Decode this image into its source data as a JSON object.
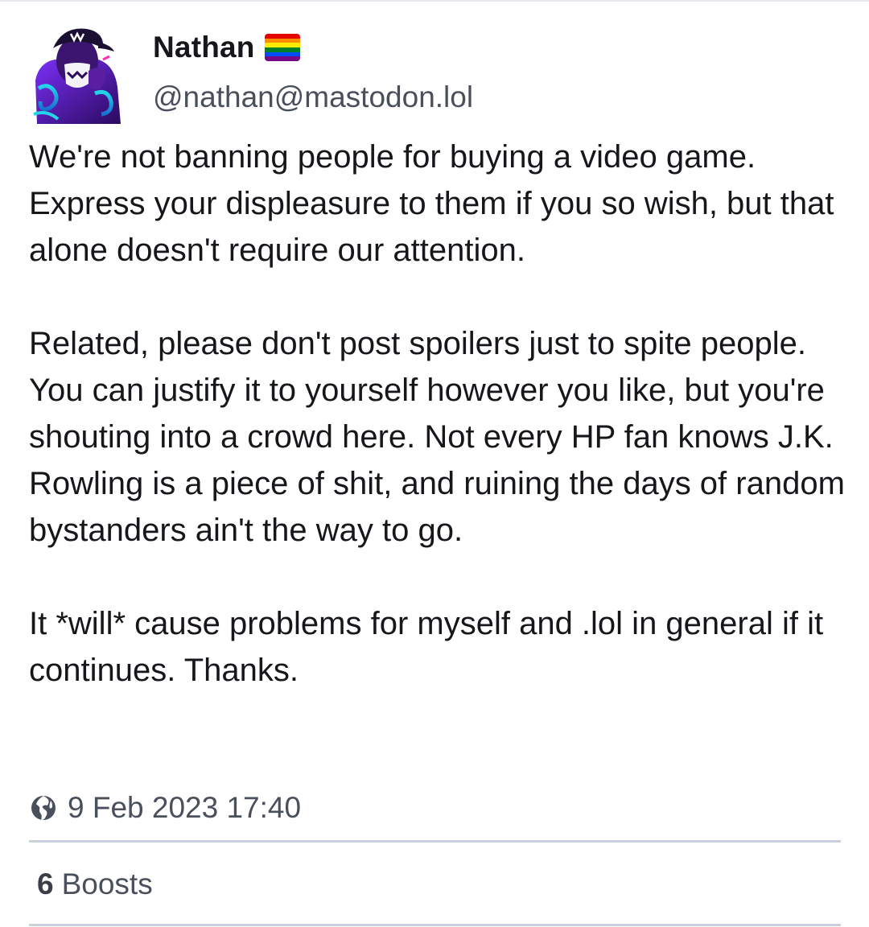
{
  "colors": {
    "text_primary": "#16171b",
    "text_secondary": "#4a4f5c",
    "divider": "#c9cfdb",
    "pride_flag": [
      "#e40303",
      "#ff8c00",
      "#ffed00",
      "#008026",
      "#004dff",
      "#750787"
    ]
  },
  "author": {
    "display_name": "Nathan",
    "flag_icon": "rainbow-flag-icon",
    "handle": "@nathan@mastodon.lol",
    "avatar_icon": "avatar"
  },
  "post": {
    "paragraphs": [
      "We're not banning people for buying a video game. Express your displeasure to them if you so wish, but that alone doesn't require our attention.",
      "Related, please don't post spoilers  just to spite people. You can justify it to yourself however you like, but you're shouting into a crowd here. Not every HP fan knows J.K. Rowling is a piece of shit, and ruining the days of random bystanders ain't the way to go.",
      "It *will* cause problems for myself and .lol in general if it continues. Thanks."
    ]
  },
  "meta": {
    "visibility_icon": "globe-icon",
    "timestamp": "9 Feb 2023 17:40"
  },
  "stats": {
    "boosts_count": "6",
    "boosts_label": "Boosts"
  }
}
